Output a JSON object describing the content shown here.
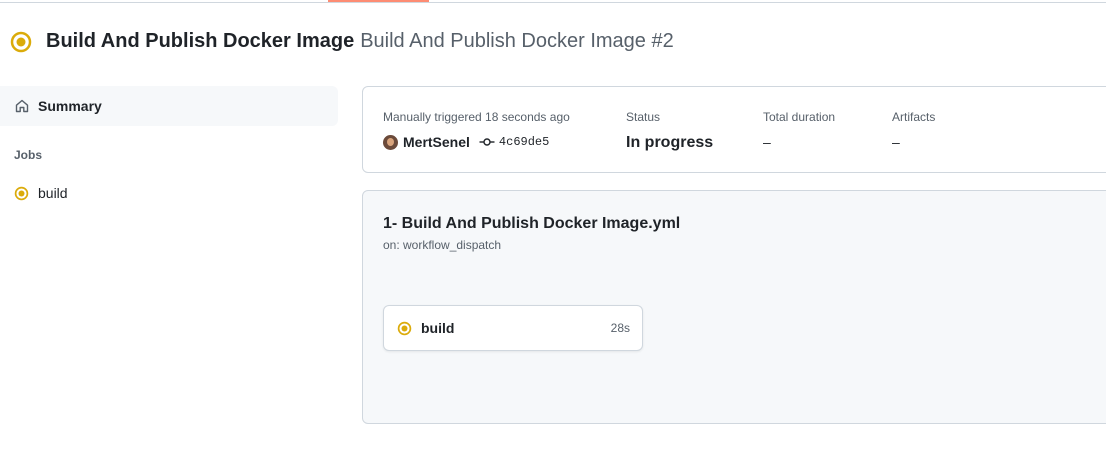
{
  "colors": {
    "in_progress": "#dbab0a",
    "tab_accent": "#fd8c73"
  },
  "header": {
    "workflow_name": "Build And Publish Docker Image",
    "run_title": "Build And Publish Docker Image #2",
    "status_icon": "in-progress-icon"
  },
  "sidebar": {
    "summary": {
      "label": "Summary",
      "icon": "home-icon"
    },
    "jobs_heading": "Jobs",
    "jobs": [
      {
        "label": "build",
        "icon": "in-progress-icon"
      }
    ]
  },
  "run": {
    "trigger_text": "Manually triggered 18 seconds ago",
    "actor": "MertSenel",
    "commit_sha": "4c69de5",
    "status_label": "Status",
    "status_value": "In progress",
    "duration_label": "Total duration",
    "duration_value": "–",
    "artifacts_label": "Artifacts",
    "artifacts_value": "–"
  },
  "graph": {
    "workflow_file": "1- Build And Publish Docker Image.yml",
    "trigger": "on: workflow_dispatch",
    "jobs": [
      {
        "name": "build",
        "duration": "28s",
        "icon": "in-progress-icon"
      }
    ]
  }
}
